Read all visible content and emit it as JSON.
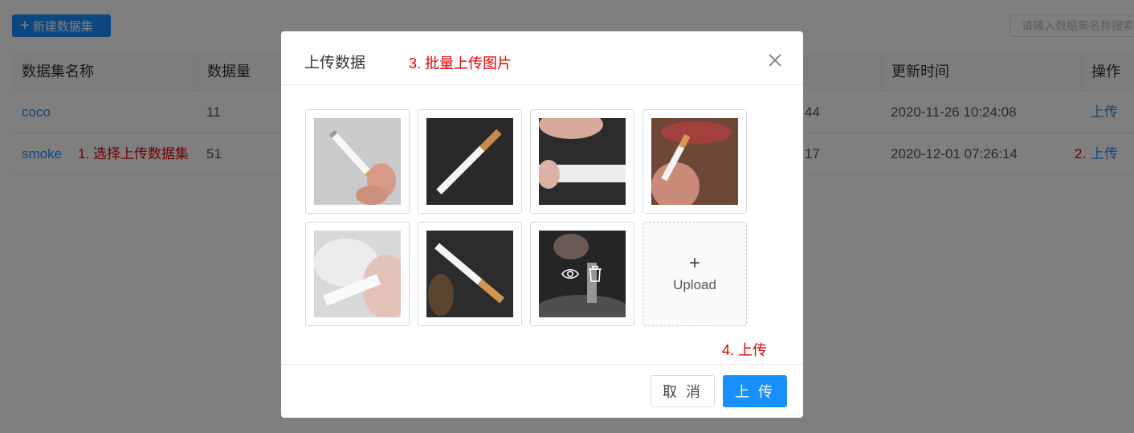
{
  "toolbar": {
    "new_button_label": "新建数据集",
    "search_placeholder": "请输入数据集名称搜索"
  },
  "table": {
    "headers": [
      "数据集名称",
      "数据量",
      "更新时间",
      "操作"
    ],
    "rows": [
      {
        "name": "coco",
        "count": "11",
        "created_suffix": "44",
        "updated": "2020-11-26 10:24:08",
        "action": "上传"
      },
      {
        "name": "smoke",
        "count": "51",
        "created_suffix": "17",
        "updated": "2020-12-01 07:26:14",
        "action": "上传"
      }
    ]
  },
  "annotations": {
    "step1": "1. 选择上传数据集",
    "step2": "2.",
    "step3": "3. 批量上传图片",
    "step4": "4. 上传"
  },
  "modal": {
    "title": "上传数据",
    "upload_tile": {
      "plus": "+",
      "label": "Upload"
    },
    "cancel_label": "取 消",
    "upload_label": "上 传"
  },
  "images": [
    {
      "name": "cigarette-hand-light"
    },
    {
      "name": "cigarette-dark"
    },
    {
      "name": "cigarette-fingers-dark"
    },
    {
      "name": "cigarette-lips"
    },
    {
      "name": "cigarette-smoke"
    },
    {
      "name": "cigarette-dark-diagonal"
    },
    {
      "name": "cigarette-ashtray-hovered"
    }
  ],
  "colors": {
    "primary": "#1890ff",
    "annotation": "#e00000"
  }
}
